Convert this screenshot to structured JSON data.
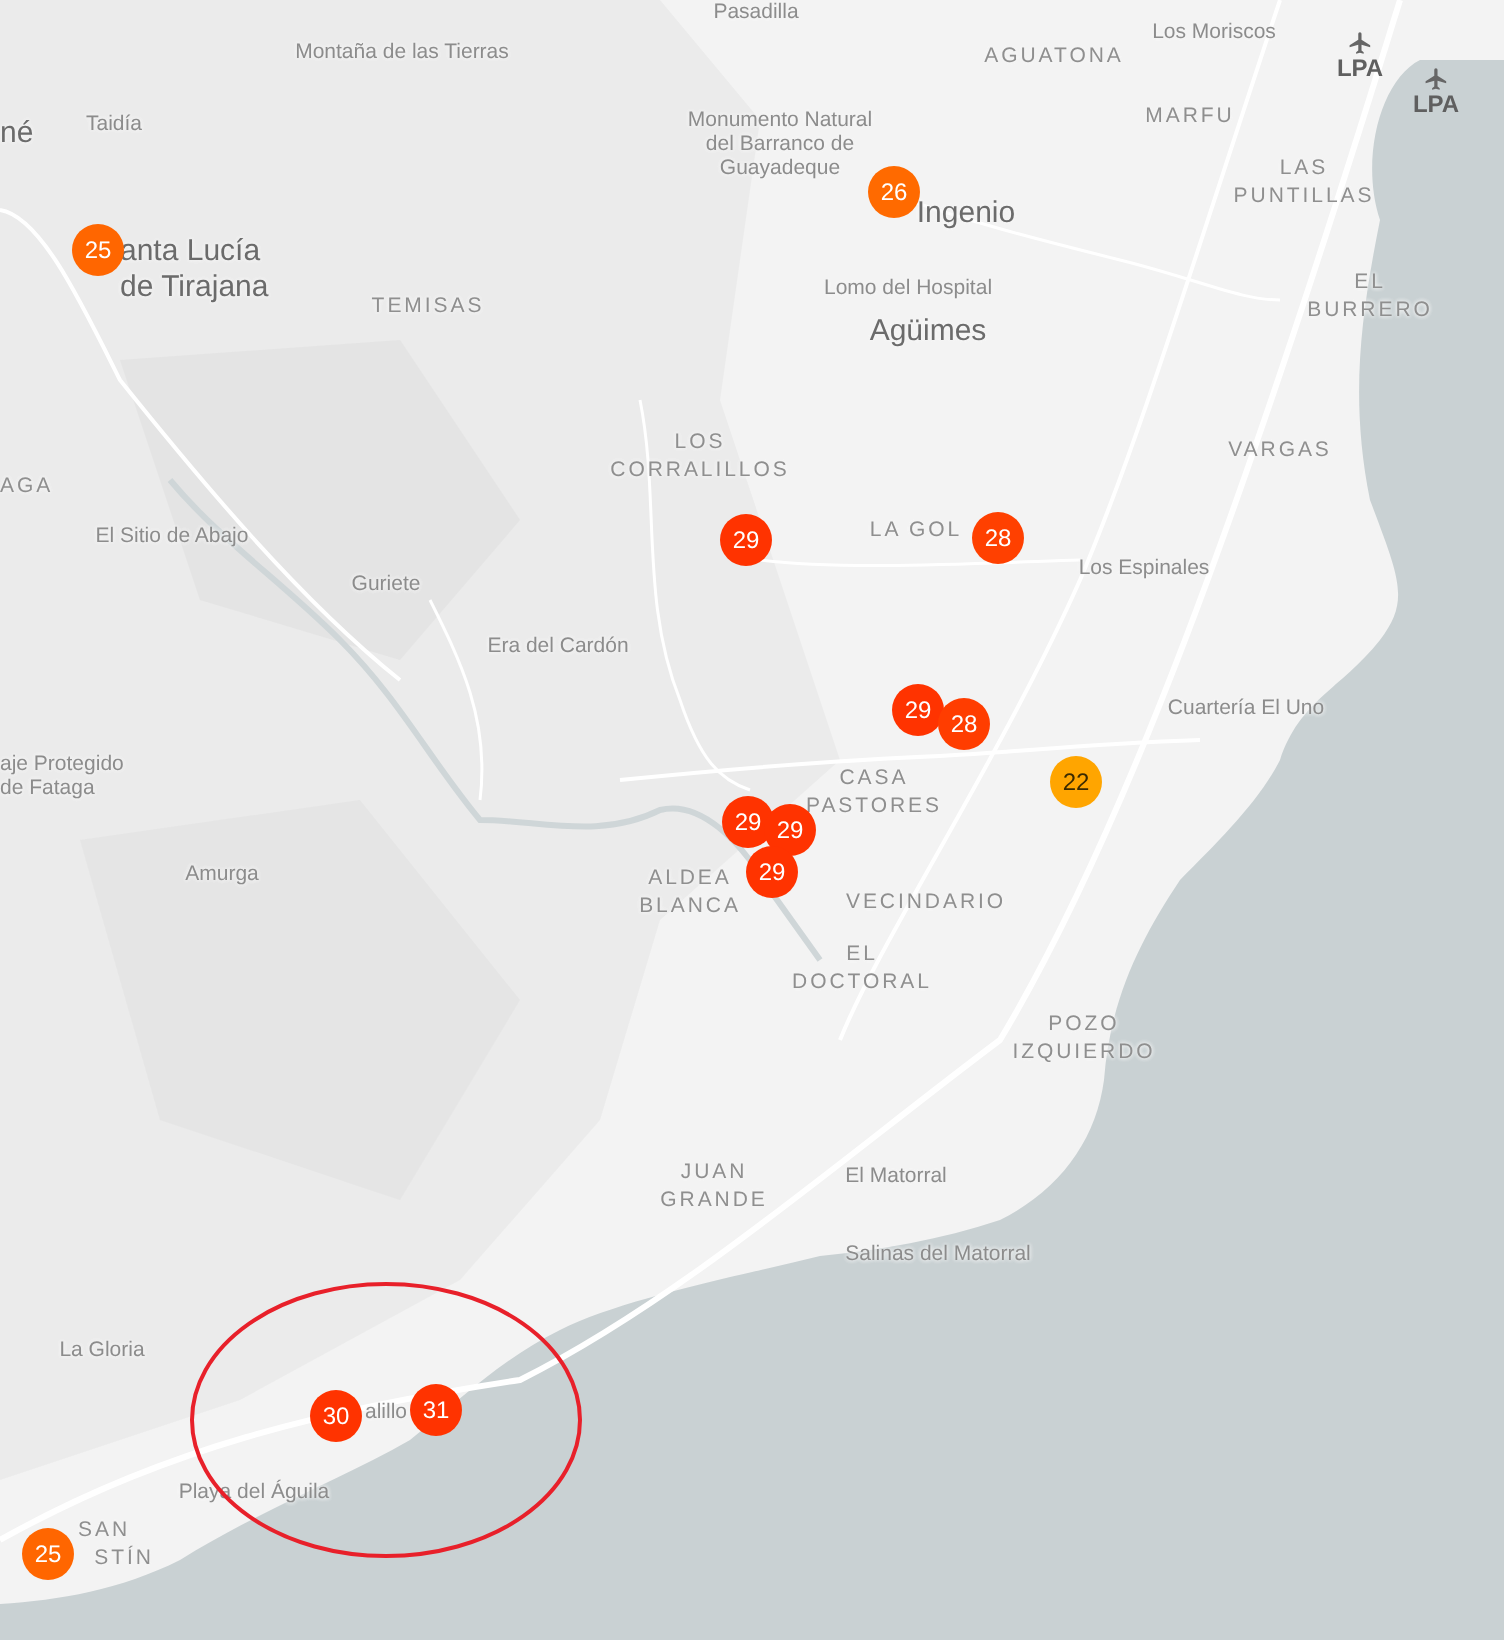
{
  "map": {
    "labels": [
      {
        "kind": "place",
        "text": "Pasadilla"
      },
      {
        "kind": "place",
        "text": "Montaña de las Tierras"
      },
      {
        "kind": "town",
        "text": "né"
      },
      {
        "kind": "place",
        "text": "Taidía"
      },
      {
        "kind": "town",
        "text": "anta Lucía\nde Tirajana"
      },
      {
        "kind": "district",
        "text": "TEMISAS"
      },
      {
        "kind": "place",
        "text": "Monumento Natural\ndel Barranco de\nGuayadeque"
      },
      {
        "kind": "district",
        "text": "AGUATONA"
      },
      {
        "kind": "place",
        "text": "Los Moriscos"
      },
      {
        "kind": "district",
        "text": "MARFU"
      },
      {
        "kind": "district",
        "text": "LAS\nPUNTILLAS"
      },
      {
        "kind": "airport",
        "text": "LPA"
      },
      {
        "kind": "airport",
        "text": "LPA"
      },
      {
        "kind": "town",
        "text": "Ingenio"
      },
      {
        "kind": "place",
        "text": "Lomo del Hospital"
      },
      {
        "kind": "town",
        "text": "Agüimes"
      },
      {
        "kind": "district",
        "text": "EL\nBURRERO"
      },
      {
        "kind": "district",
        "text": "VARGAS"
      },
      {
        "kind": "district",
        "text": "LOS\nCORRALILLOS"
      },
      {
        "kind": "district",
        "text": "LA GOL"
      },
      {
        "kind": "place",
        "text": "Los Espinales"
      },
      {
        "kind": "district",
        "text": "AGA"
      },
      {
        "kind": "place",
        "text": "El Sitio de Abajo"
      },
      {
        "kind": "place",
        "text": "Guriete"
      },
      {
        "kind": "place",
        "text": "Era del Cardón"
      },
      {
        "kind": "place",
        "text": "Cuartería El Uno"
      },
      {
        "kind": "place",
        "text": "aje Protegido\nde Fataga"
      },
      {
        "kind": "place",
        "text": "Amurga"
      },
      {
        "kind": "district",
        "text": "CASA\nPASTORES"
      },
      {
        "kind": "district",
        "text": "ALDEA\nBLANCA"
      },
      {
        "kind": "district",
        "text": "VECINDARIO"
      },
      {
        "kind": "district",
        "text": "EL\nDOCTORAL"
      },
      {
        "kind": "district",
        "text": "POZO\nIZQUIERDO"
      },
      {
        "kind": "district",
        "text": "JUAN\nGRANDE"
      },
      {
        "kind": "place",
        "text": "El Matorral"
      },
      {
        "kind": "place",
        "text": "Salinas del Matorral"
      },
      {
        "kind": "place",
        "text": "La Gloria"
      },
      {
        "kind": "place",
        "text": "alillo"
      },
      {
        "kind": "place",
        "text": "Playa del Águila"
      },
      {
        "kind": "district",
        "text": "SAN"
      },
      {
        "kind": "district",
        "text": "STÍN"
      }
    ],
    "markers": [
      {
        "value": "25",
        "color": "#ff6600"
      },
      {
        "value": "26",
        "color": "#ff6a00"
      },
      {
        "value": "29",
        "color": "#ff3300"
      },
      {
        "value": "28",
        "color": "#ff4000"
      },
      {
        "value": "29",
        "color": "#ff3300"
      },
      {
        "value": "28",
        "color": "#ff3d00"
      },
      {
        "value": "22",
        "color": "#ffa500"
      },
      {
        "value": "29",
        "color": "#ff3300"
      },
      {
        "value": "29",
        "color": "#ff3300"
      },
      {
        "value": "29",
        "color": "#ff3300"
      },
      {
        "value": "30",
        "color": "#ff3300"
      },
      {
        "value": "31",
        "color": "#ff3300"
      },
      {
        "value": "25",
        "color": "#ff6600"
      }
    ]
  }
}
